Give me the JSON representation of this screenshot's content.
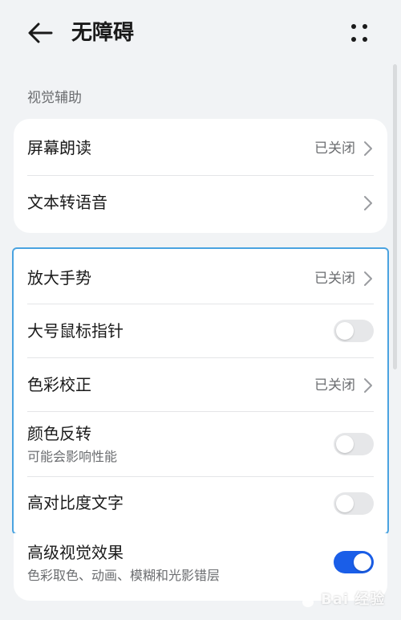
{
  "header": {
    "title": "无障碍",
    "back_icon": "arrow-left-icon",
    "more_icon": "more-vertical-dots-icon"
  },
  "section": {
    "label": "视觉辅助"
  },
  "group1": [
    {
      "label": "屏幕朗读",
      "value": "已关闭"
    },
    {
      "label": "文本转语音",
      "value": ""
    }
  ],
  "group2": [
    {
      "label": "放大手势",
      "value": "已关闭"
    },
    {
      "label": "大号鼠标指针",
      "toggle": false
    },
    {
      "label": "色彩校正",
      "value": "已关闭"
    },
    {
      "label": "颜色反转",
      "sub": "可能会影响性能",
      "toggle": false
    },
    {
      "label": "高对比度文字",
      "toggle": false
    }
  ],
  "group3": [
    {
      "label": "高级视觉效果",
      "sub": "色彩取色、动画、模糊和光影错层",
      "toggle": true
    }
  ],
  "watermark": {
    "text": "Bai 经验",
    "icon": "baidu-paw-icon"
  },
  "colors": {
    "background": "#f1f3f5",
    "card": "#ffffff",
    "accent": "#1a5ee8",
    "highlight_border": "#4aa3e0",
    "secondary_text": "#6b6d70"
  }
}
